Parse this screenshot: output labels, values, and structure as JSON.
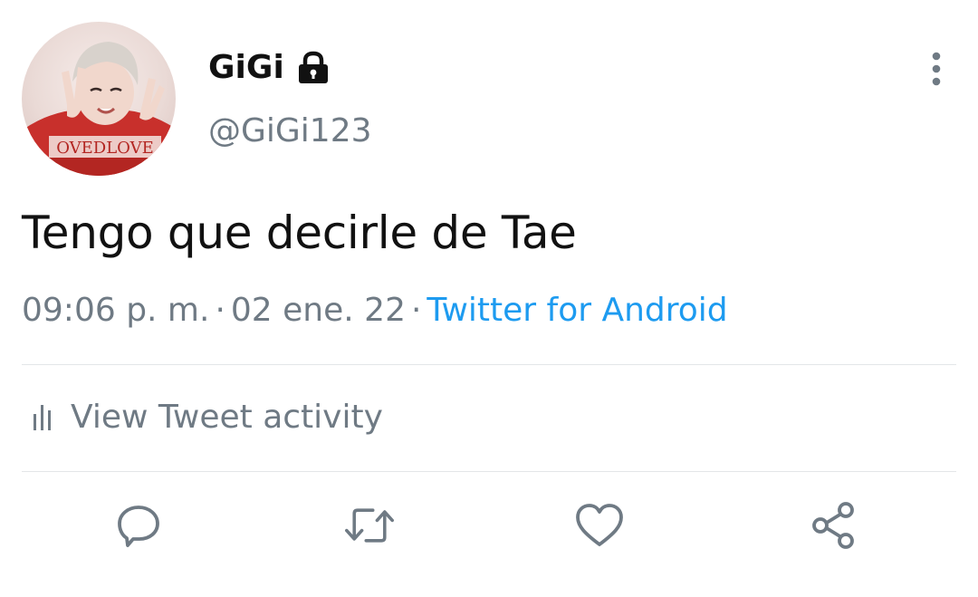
{
  "tweet": {
    "author": {
      "display_name": "GiGi",
      "handle": "@GiGi123",
      "protected": true,
      "avatar_shirt_text": "OVEDLOVE"
    },
    "text": "Tengo que decirle de Tae",
    "time": "09:06 p. m.",
    "date": "02 ene. 22",
    "separator": "·",
    "source": "Twitter for Android",
    "activity_label": "View Tweet activity"
  },
  "icons": {
    "lock": "lock-icon",
    "more": "more-vertical-icon",
    "activity": "bar-chart-icon",
    "reply": "reply-icon",
    "retweet": "retweet-icon",
    "like": "heart-icon",
    "share": "share-icon"
  },
  "colors": {
    "text_primary": "#111111",
    "text_secondary": "#6f7a84",
    "link": "#1d9bf0",
    "divider": "#e3e6e8"
  }
}
